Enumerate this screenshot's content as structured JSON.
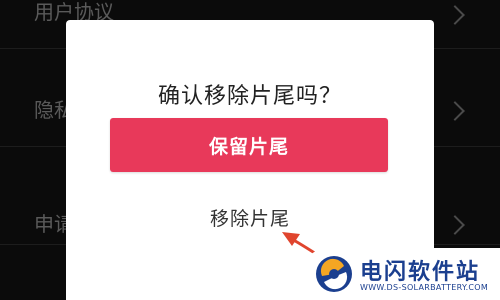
{
  "background": {
    "items": [
      {
        "label": "用户协议"
      },
      {
        "label": "隐私政策"
      },
      {
        "label": "申请权限"
      }
    ]
  },
  "dialog": {
    "title": "确认移除片尾吗？",
    "keep_button": "保留片尾",
    "remove_button": "移除片尾",
    "accent_color": "#e8395a"
  },
  "annotation": {
    "arrow_color": "#e0452e",
    "icon": "arrow-pointer-icon"
  },
  "watermark": {
    "name": "电闪软件站",
    "url": "WWW.DS-SOLARBATTERY.COM",
    "icon": "brand-logo-icon"
  }
}
